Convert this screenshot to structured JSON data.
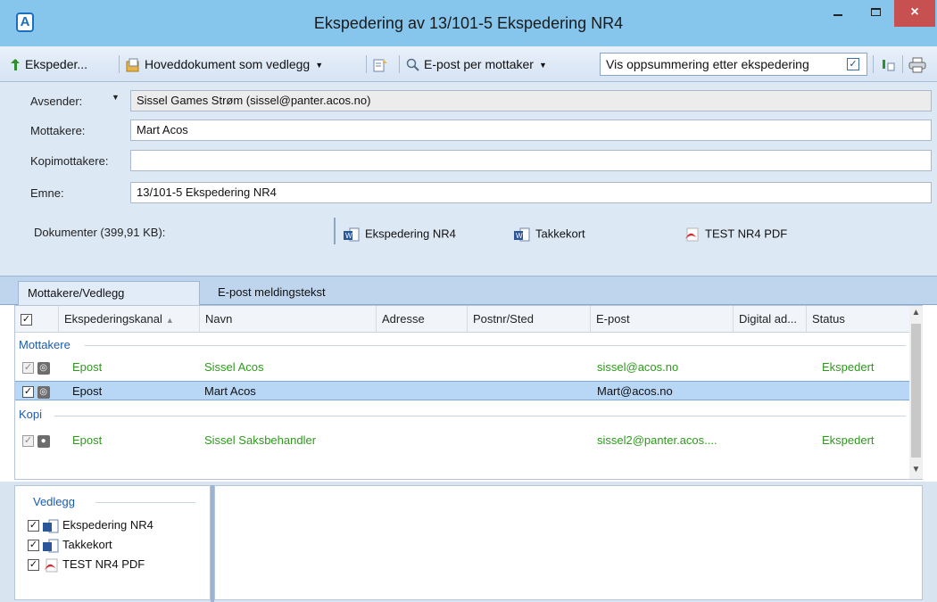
{
  "window": {
    "title": "Ekspedering av 13/101-5 Ekspedering NR4",
    "app_icon": "A",
    "close_glyph": "×"
  },
  "toolbar": {
    "ekspeder_label": "Ekspeder...",
    "hoveddok_label": "Hoveddokument som vedlegg",
    "epost_label": "E-post per mottaker",
    "vis_label": "Vis oppsummering etter ekspedering",
    "vis_checked": true
  },
  "form": {
    "avsender_label": "Avsender:",
    "avsender_value": "Sissel Games Strøm (sissel@panter.acos.no)",
    "mottakere_label": "Mottakere:",
    "mottakere_value": "Mart Acos",
    "kopi_label": "Kopimottakere:",
    "kopi_value": "",
    "emne_label": "Emne:",
    "emne_value": "13/101-5 Ekspedering NR4",
    "docs_label": "Dokumenter (399,91 KB):",
    "docs": [
      {
        "name": "Ekspedering NR4",
        "icon": "word-doc-icon"
      },
      {
        "name": "Takkekort",
        "icon": "word-doc-icon"
      },
      {
        "name": "TEST NR4 PDF",
        "icon": "pdf-icon"
      }
    ]
  },
  "tabs": {
    "mottakere": "Mottakere/Vedlegg",
    "epost": "E-post meldingstekst"
  },
  "grid": {
    "headers": {
      "kanal": "Ekspederingskanal",
      "navn": "Navn",
      "adresse": "Adresse",
      "postnr": "Postnr/Sted",
      "epost": "E-post",
      "digital": "Digital ad...",
      "status": "Status"
    },
    "group_mottakere": "Mottakere",
    "group_kopi": "Kopi",
    "rows": [
      {
        "kanal": "Epost",
        "navn": "Sissel Acos",
        "epost": "sissel@acos.no",
        "status": "Ekspedert"
      },
      {
        "kanal": "Epost",
        "navn": "Mart Acos",
        "epost": "Mart@acos.no",
        "status": ""
      },
      {
        "kanal": "Epost",
        "navn": "Sissel Saksbehandler",
        "epost": "sissel2@panter.acos....",
        "status": "Ekspedert"
      }
    ]
  },
  "vedlegg": {
    "title": "Vedlegg",
    "items": [
      {
        "name": "Ekspedering NR4",
        "icon": "word-doc-icon"
      },
      {
        "name": "Takkekort",
        "icon": "word-doc-icon"
      },
      {
        "name": "TEST NR4 PDF",
        "icon": "pdf-icon"
      }
    ]
  },
  "colors": {
    "titlebar": "#86c6ec",
    "accent_blue": "#1b5cad",
    "sent_green": "#2d9a1c",
    "selection": "#b8d6f5"
  }
}
